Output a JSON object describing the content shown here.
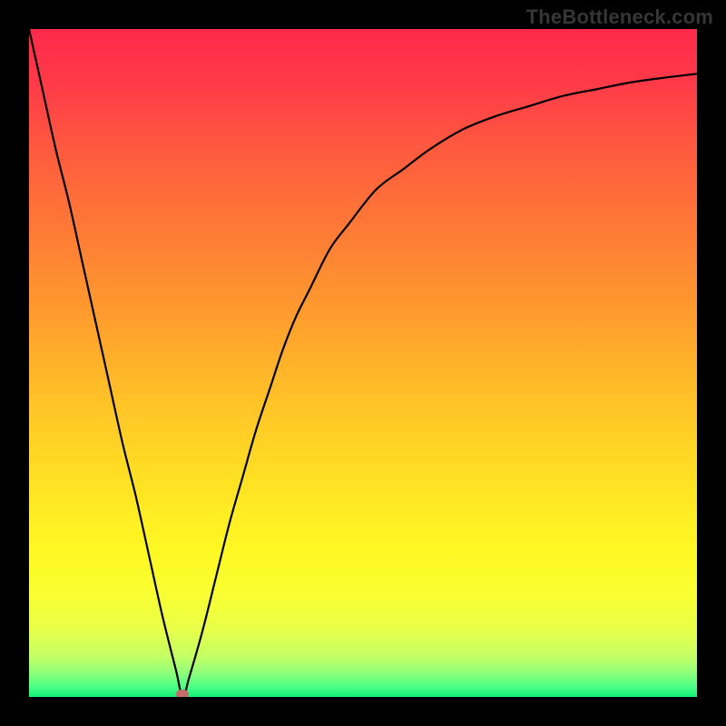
{
  "watermark": "TheBottleneck.com",
  "chart_data": {
    "type": "line",
    "title": "",
    "xlabel": "",
    "ylabel": "",
    "xlim": [
      0,
      100
    ],
    "ylim": [
      0,
      100
    ],
    "grid": false,
    "series": [
      {
        "name": "bottleneck-curve",
        "x": [
          0,
          2,
          4,
          6,
          8,
          10,
          12,
          14,
          16,
          18,
          20,
          22,
          23,
          24,
          26,
          28,
          30,
          32,
          34,
          36,
          38,
          40,
          42,
          45,
          48,
          52,
          56,
          60,
          65,
          70,
          75,
          80,
          85,
          90,
          95,
          100
        ],
        "y": [
          100,
          91,
          82,
          74,
          65,
          56,
          47,
          38,
          30,
          21,
          12,
          4,
          0,
          3,
          10,
          18,
          26,
          33,
          40,
          46,
          52,
          57,
          61,
          67,
          71,
          76,
          79,
          82,
          85,
          87,
          88.5,
          90,
          91,
          92,
          92.7,
          93.3
        ]
      }
    ],
    "min_point": {
      "x": 23,
      "y": 0
    },
    "marker_color": "#c86a6a",
    "gradient_stops": [
      {
        "offset": 0.0,
        "color": "#ff2a4b"
      },
      {
        "offset": 0.08,
        "color": "#ff3a48"
      },
      {
        "offset": 0.18,
        "color": "#ff5a3f"
      },
      {
        "offset": 0.3,
        "color": "#ff7a36"
      },
      {
        "offset": 0.42,
        "color": "#ff9a2e"
      },
      {
        "offset": 0.55,
        "color": "#ffc028"
      },
      {
        "offset": 0.68,
        "color": "#ffe223"
      },
      {
        "offset": 0.78,
        "color": "#fff823"
      },
      {
        "offset": 0.85,
        "color": "#f8ff33"
      },
      {
        "offset": 0.9,
        "color": "#e8ff4a"
      },
      {
        "offset": 0.94,
        "color": "#c3ff66"
      },
      {
        "offset": 0.965,
        "color": "#8cff7a"
      },
      {
        "offset": 0.985,
        "color": "#4bff86"
      },
      {
        "offset": 1.0,
        "color": "#14f07a"
      }
    ]
  }
}
